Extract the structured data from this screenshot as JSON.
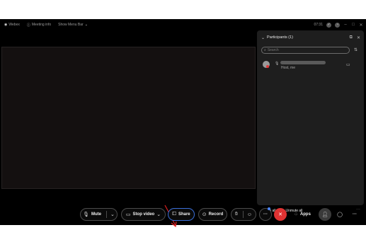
{
  "titlebar": {
    "app": "Webex",
    "meeting_info": "Meeting info",
    "show_menu_bar": "Show Menu Bar",
    "time": "07:31"
  },
  "participants_panel": {
    "title": "Participants (1)",
    "search_placeholder": "Search",
    "participant": {
      "role": "Host, me"
    },
    "mute_all": "Mute all",
    "unmute_all": "Unmute all",
    "more": "···"
  },
  "controls": {
    "mute": "Mute",
    "stop_video": "Stop video",
    "share": "Share",
    "record": "Record",
    "apps": "Apps",
    "more": "···"
  },
  "colors": {
    "background": "#000000",
    "panel": "#1e1e1e",
    "end_call": "#e03333",
    "share_outline": "#3b6fd9",
    "annotation_arrow": "#e02020"
  },
  "icons": [
    "webex-icon",
    "info-icon",
    "chevron-down-icon",
    "mic-icon",
    "video-icon",
    "share-icon",
    "record-icon",
    "reactions-icon",
    "end-call-icon",
    "apps-icon",
    "participants-icon",
    "chat-icon",
    "search-icon",
    "sort-icon",
    "popout-icon",
    "close-icon"
  ]
}
